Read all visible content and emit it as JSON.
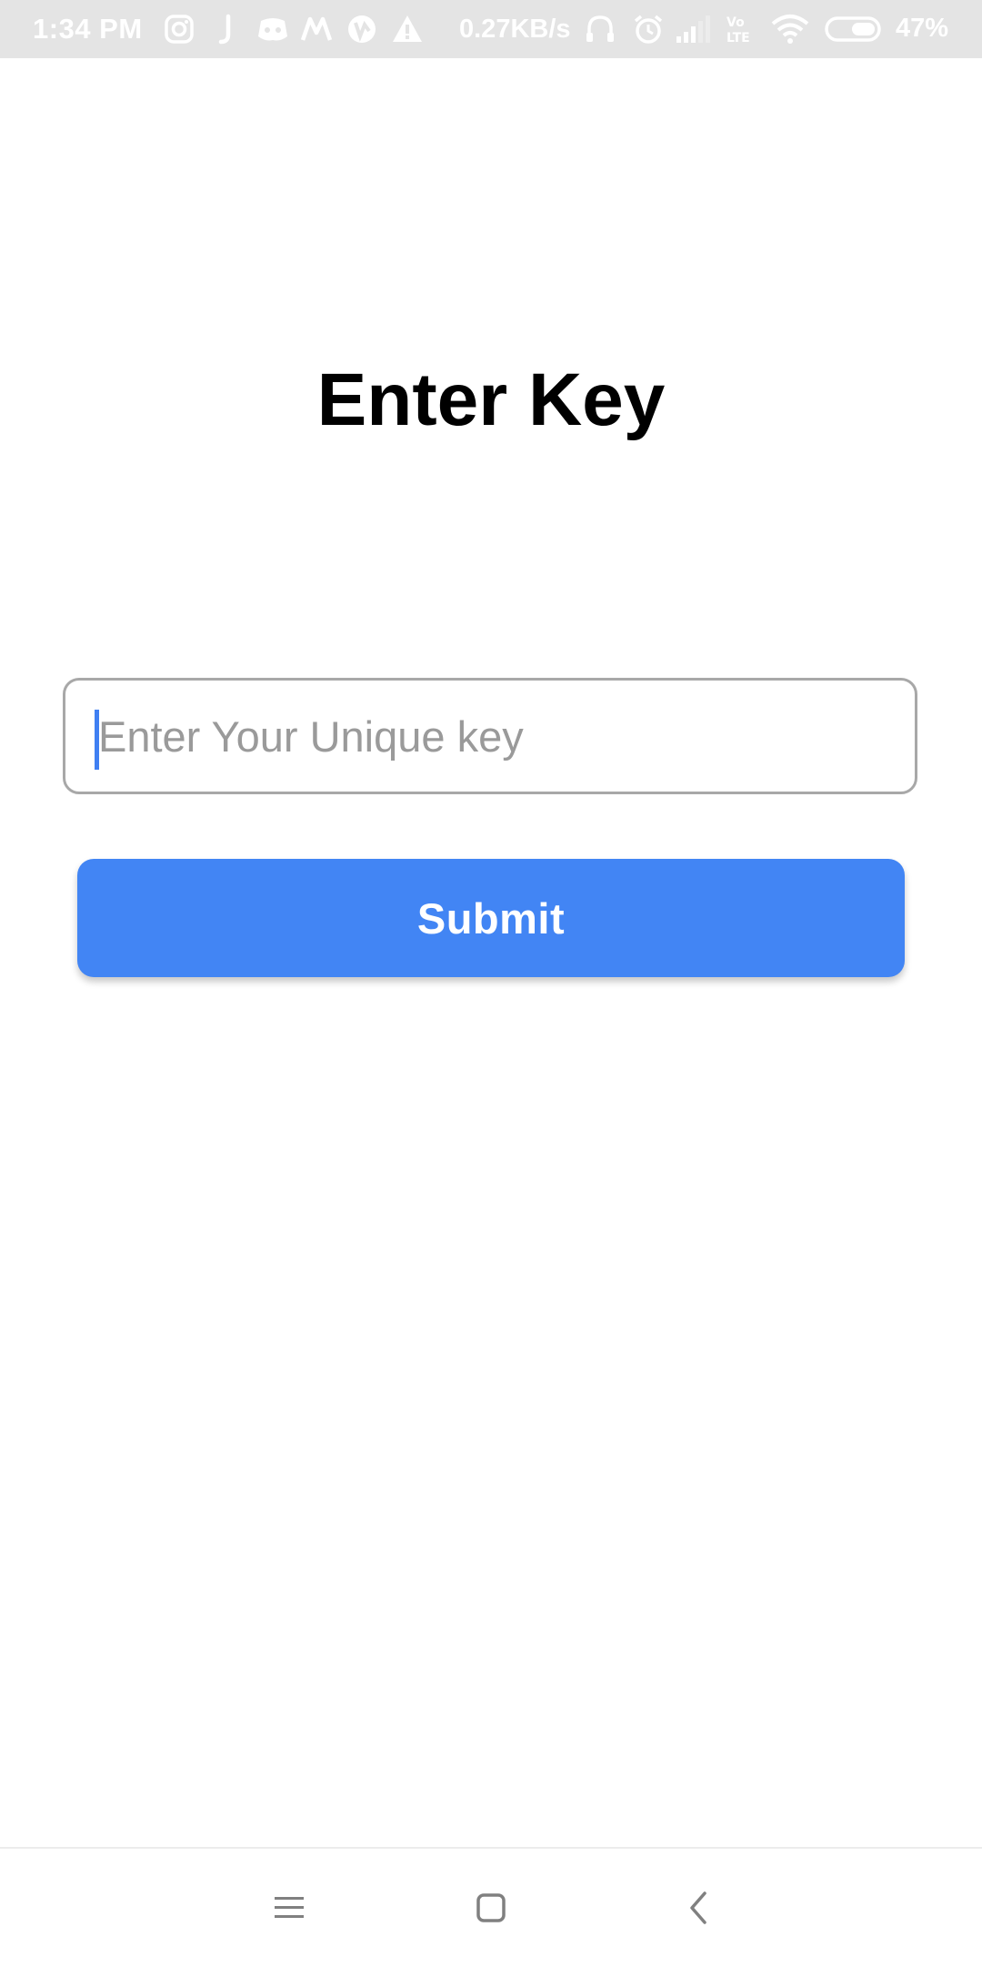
{
  "status_bar": {
    "time": "1:34 PM",
    "network_speed": "0.27KB/s",
    "battery_percent": "47%",
    "icons": [
      "instagram-icon",
      "j-app-icon",
      "discord-icon",
      "m-app-icon",
      "vpn-icon",
      "warning-icon",
      "headphones-icon",
      "alarm-icon",
      "signal-icon",
      "volte-icon",
      "wifi-icon",
      "battery-icon"
    ]
  },
  "page": {
    "title": "Enter Key"
  },
  "key_input": {
    "placeholder": "Enter Your Unique key",
    "value": ""
  },
  "submit_button": {
    "label": "Submit"
  },
  "nav_bar": {
    "buttons": [
      "menu-icon",
      "home-icon",
      "back-icon"
    ]
  },
  "colors": {
    "accent": "#4285f4",
    "caret": "#3f7ff2",
    "status_bar_bg": "#e4e4e4",
    "input_border": "#a8a8a8",
    "placeholder": "#9a9a9a",
    "title": "#000000"
  }
}
